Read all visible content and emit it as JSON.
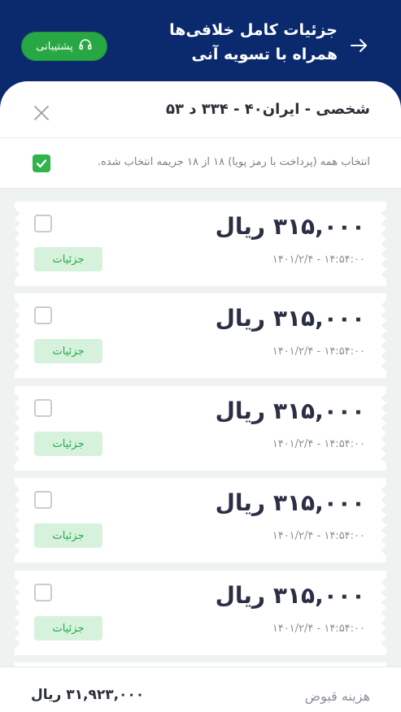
{
  "header": {
    "title_line1": "جزئیات کامل خلافی‌ها",
    "title_line2": "همراه با تسویه آنی",
    "support_label": "پشتیبانی",
    "back_icon": "arrow-right-icon",
    "support_icon": "headset-icon"
  },
  "plate": {
    "title": "شخصی - ایران۴۰ - ۳۳۴ د ۵۳",
    "close_icon": "close-icon"
  },
  "selection": {
    "label": "انتخاب همه (پرداخت با رمز پویا) ۱۸ از ۱۸ جریمه انتخاب شده.",
    "checked": true
  },
  "fines": [
    {
      "amount": "۳۱۵,۰۰۰ ریال",
      "datetime": "۱۴۰۱/۲/۴ - ۱۴:۵۴:۰۰",
      "details_label": "جزئیات",
      "checked": false
    },
    {
      "amount": "۳۱۵,۰۰۰ ریال",
      "datetime": "۱۴۰۱/۲/۴ - ۱۴:۵۴:۰۰",
      "details_label": "جزئیات",
      "checked": false
    },
    {
      "amount": "۳۱۵,۰۰۰ ریال",
      "datetime": "۱۴۰۱/۲/۴ - ۱۴:۵۴:۰۰",
      "details_label": "جزئیات",
      "checked": false
    },
    {
      "amount": "۳۱۵,۰۰۰ ریال",
      "datetime": "۱۴۰۱/۲/۴ - ۱۴:۵۴:۰۰",
      "details_label": "جزئیات",
      "checked": false
    },
    {
      "amount": "۳۱۵,۰۰۰ ریال",
      "datetime": "۱۴۰۱/۲/۴ - ۱۴:۵۴:۰۰",
      "details_label": "جزئیات",
      "checked": false
    }
  ],
  "footer": {
    "label": "هزینه قبوض",
    "total": "۳۱,۹۲۳,۰۰۰ ریال"
  },
  "colors": {
    "header_bg": "#0b2a6e",
    "accent_green": "#27a844",
    "details_bg": "#d6f2dd"
  }
}
